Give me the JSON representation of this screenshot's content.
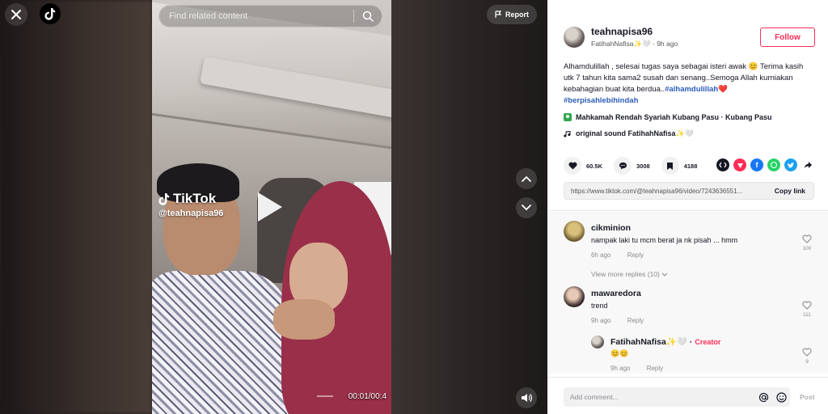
{
  "player": {
    "search_placeholder": "Find related content",
    "report_label": "Report",
    "watermark_logo": "TikTok",
    "watermark_user": "@teahnapisa96",
    "timecode": "00:01/00:4"
  },
  "author": {
    "username": "teahnapisa96",
    "nickname": "FatihahNafisa✨🤍",
    "time_ago": "9h ago",
    "follow_label": "Follow"
  },
  "caption": {
    "text_1": "Alhamdulillah , selesai tugas saya sebagai isteri awak 😊 Terima kasih utk 7 tahun kita sama2 susah dan senang..Semoga Allah kurniakan kebahagian buat kita berdua..",
    "hashtag_1": "#alhamdulillah",
    "heart": "❤️",
    "hashtag_2": "#berpisahlebihindah"
  },
  "location": "Mahkamah Rendah Syariah Kubang Pasu · Kubang Pasu",
  "sound": "original sound FatihahNafisa✨🤍",
  "actions": {
    "likes": "60.5K",
    "comments": "3008",
    "saves": "4188"
  },
  "share_colors": {
    "embed": "#161823",
    "tiktok": "#fe2c55",
    "facebook": "#1877f2",
    "whatsapp": "#25d366",
    "twitter": "#1da1f2"
  },
  "link": {
    "url": "https://www.tiktok.com/@teahnapisa96/video/7243636551...",
    "copy_label": "Copy link"
  },
  "comments": [
    {
      "name": "cikminion",
      "text": "nampak laki tu mcm berat ja nk pisah ... hmm",
      "time": "6h ago",
      "reply": "Reply",
      "likes": "100"
    },
    {
      "name": "mawaredora",
      "text": "trend",
      "time": "9h ago",
      "reply": "Reply",
      "likes": "111"
    }
  ],
  "view_more": "View more replies (10)",
  "creator_reply": {
    "name": "FatihahNafisa✨🤍",
    "sep": "·",
    "badge": "Creator",
    "text": "😊😊",
    "time": "9h ago",
    "reply": "Reply",
    "likes": "9"
  },
  "footer": {
    "placeholder": "Add comment...",
    "post_label": "Post"
  }
}
